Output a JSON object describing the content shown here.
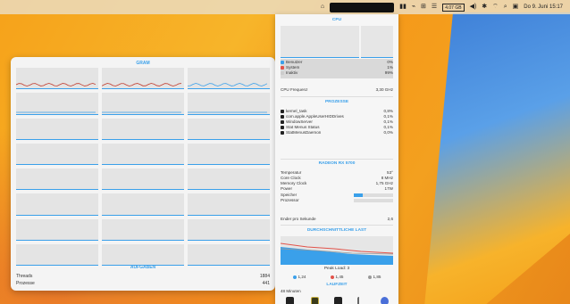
{
  "menubar": {
    "items": [
      "⌂",
      "▮▮",
      "⌁",
      "⊞",
      "☰"
    ],
    "box1": "4.07 GB",
    "volume_icon": "speaker-icon",
    "bt": "✱",
    "wifi": "wifi-icon",
    "search": "search-icon",
    "lock": "lock-icon",
    "date": "Do 9. Juni 15:17"
  },
  "left_window": {
    "title": "GRAM",
    "section_title": "AUFGABEN",
    "rows": [
      {
        "label": "Threads",
        "value": "1884"
      },
      {
        "label": "Prozesse",
        "value": "441"
      }
    ],
    "cell_count": 24
  },
  "right_panel": {
    "cpu_title": "CPU",
    "cpu_legend": [
      {
        "label": "Benutzer",
        "value": "0%",
        "color": "#3aa0ea"
      },
      {
        "label": "System",
        "value": "1%",
        "color": "#e2534a"
      },
      {
        "label": "Inaktiv",
        "value": "99%",
        "color": "#cccccc"
      }
    ],
    "cpu_freq": {
      "label": "CPU Frequenz",
      "value": "3,30 GHz"
    },
    "prozesse_title": "PROZESSE",
    "processes": [
      {
        "name": "kernel_task",
        "value": "0,8%"
      },
      {
        "name": "com.apple.AppleUserHIDDrives",
        "value": "0,1%"
      },
      {
        "name": "WindowServer",
        "value": "0,1%"
      },
      {
        "name": "Stat Menus Status",
        "value": "0,1%"
      },
      {
        "name": "StatMenusDaemon",
        "value": "0,0%"
      }
    ],
    "gpu_title": "RADEON RX 5700",
    "gpu_rows": [
      {
        "label": "Temperatur",
        "value": "53°"
      },
      {
        "label": "Core Clock",
        "value": "8 MHz"
      },
      {
        "label": "Memory Clock",
        "value": "1,75 GHz"
      },
      {
        "label": "Power",
        "value": "17W"
      }
    ],
    "gpu_bars": [
      {
        "label": "Speicher",
        "fill": 0.22
      },
      {
        "label": "Prozessor",
        "fill": 0.0
      }
    ],
    "avg": {
      "label": "Ender pro Sekunde",
      "value": "2,6"
    },
    "load_title": "DURCHSCHNITTLICHE LAST",
    "peak": "Peak Load: 3",
    "load_legend": [
      {
        "label": "1,24",
        "color": "#3aa0ea"
      },
      {
        "label": "1,45",
        "color": "#e2534a"
      },
      {
        "label": "1,85",
        "color": "#999999"
      }
    ],
    "laufzeit_title": "LAUFZEIT",
    "laufzeit_value": "48 Minuten",
    "dock_icons": [
      "terminal-icon",
      "app-icon",
      "terminal-icon",
      "ruler-icon",
      "globe-icon"
    ]
  }
}
